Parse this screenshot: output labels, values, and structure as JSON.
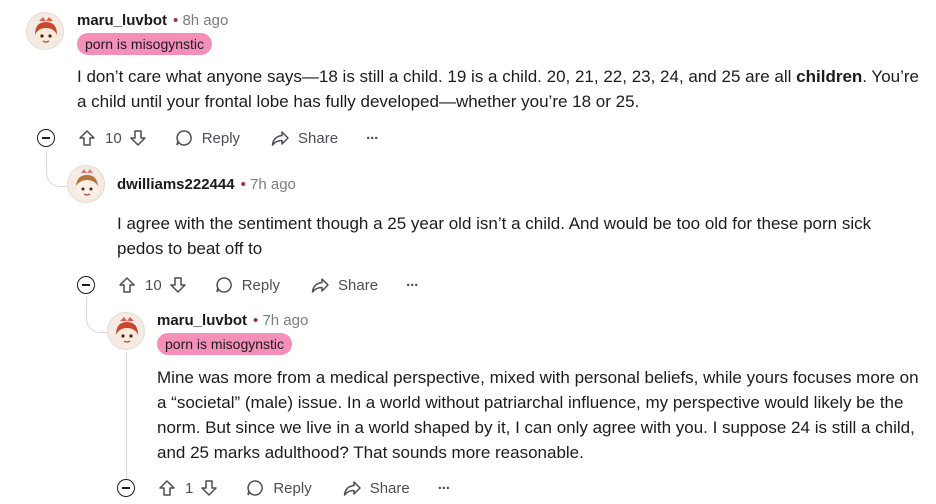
{
  "comments": [
    {
      "username": "maru_luvbot",
      "time": "8h ago",
      "flair": "porn is misogynstic",
      "body_pre": "I don’t care what anyone says—18 is still a child. 19 is a child. 20, 21, 22, 23, 24, and 25 are all ",
      "body_bold": "children",
      "body_post": ". You’re a child until your frontal lobe has fully developed—whether you’re 18 or 25.",
      "votes": "10",
      "reply_label": "Reply",
      "share_label": "Share",
      "more_label": "···"
    },
    {
      "username": "dwilliams222444",
      "time": "7h ago",
      "body": "I agree with the sentiment though a 25 year old isn’t a child. And would be too old for these porn sick pedos to beat off to",
      "votes": "10",
      "reply_label": "Reply",
      "share_label": "Share",
      "more_label": "···"
    },
    {
      "username": "maru_luvbot",
      "time": "7h ago",
      "flair": "porn is misogynstic",
      "body": "Mine was more from a medical perspective, mixed with personal beliefs, while yours focuses more on a “societal” (male) issue. In a world without patriarchal influence, my perspective would likely be the norm. But since we live in a world shaped by it, I can only agree with you. I suppose 24 is still a child, and 25 marks adulthood? That sounds more reasonable.",
      "votes": "1",
      "reply_label": "Reply",
      "share_label": "Share",
      "more_label": "···"
    }
  ],
  "separator": "•",
  "icons": [
    "avatar-illustration",
    "collapse-icon",
    "upvote-icon",
    "downvote-icon",
    "comment-bubble-icon",
    "share-arrow-icon",
    "more-options-icon"
  ],
  "colors": {
    "flair_bg": "#f48fba",
    "thread_line": "#d5d9dc",
    "time_dot": "#a32c56"
  }
}
